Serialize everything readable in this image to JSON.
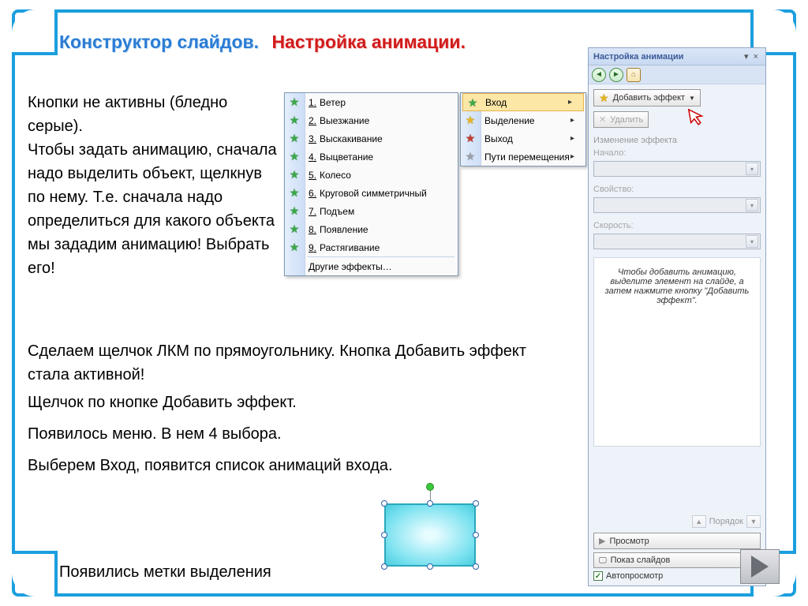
{
  "heading": {
    "part1": "Конструктор слайдов.",
    "part2": "Настройка анимации."
  },
  "text": {
    "p1": "Кнопки не активны (бледно серые).\nЧтобы задать анимацию, сначала надо выделить объект, щелкнув по нему. Т.е. сначала надо определиться для какого объекта мы зададим анимацию! Выбрать его!",
    "p2": "Сделаем щелчок ЛКМ по прямоугольнику. Кнопка Добавить эффект стала активной!",
    "p3": "Щелчок по кнопке Добавить эффект.",
    "p4": "Появилось меню. В нем 4 выбора.",
    "p5": "Выберем Вход, появится список анимаций входа.",
    "p6": "Появились метки выделения"
  },
  "menu1": {
    "items": [
      {
        "n": "1.",
        "label": "Ветер"
      },
      {
        "n": "2.",
        "label": "Выезжание"
      },
      {
        "n": "3.",
        "label": "Выскакивание"
      },
      {
        "n": "4.",
        "label": "Выцветание"
      },
      {
        "n": "5.",
        "label": "Колесо"
      },
      {
        "n": "6.",
        "label": "Круговой симметричный"
      },
      {
        "n": "7.",
        "label": "Подъем"
      },
      {
        "n": "8.",
        "label": "Появление"
      },
      {
        "n": "9.",
        "label": "Растягивание"
      }
    ],
    "other": "Другие эффекты…"
  },
  "menu2": {
    "items": [
      {
        "label": "Вход",
        "icon": "green"
      },
      {
        "label": "Выделение",
        "icon": "yellow"
      },
      {
        "label": "Выход",
        "icon": "red"
      },
      {
        "label": "Пути перемещения",
        "icon": "grey"
      }
    ]
  },
  "pane": {
    "title": "Настройка анимации",
    "add_effect": "Добавить эффект",
    "delete": "Удалить",
    "change_header": "Изменение эффекта",
    "labels": {
      "start": "Начало:",
      "property": "Свойство:",
      "speed": "Скорость:"
    },
    "hint": "Чтобы добавить анимацию, выделите элемент на слайде, а затем нажмите кнопку \"Добавить эффект\".",
    "order": "Порядок",
    "preview": "Просмотр",
    "slideshow": "Показ слайдов",
    "autoview": "Автопросмотр"
  }
}
